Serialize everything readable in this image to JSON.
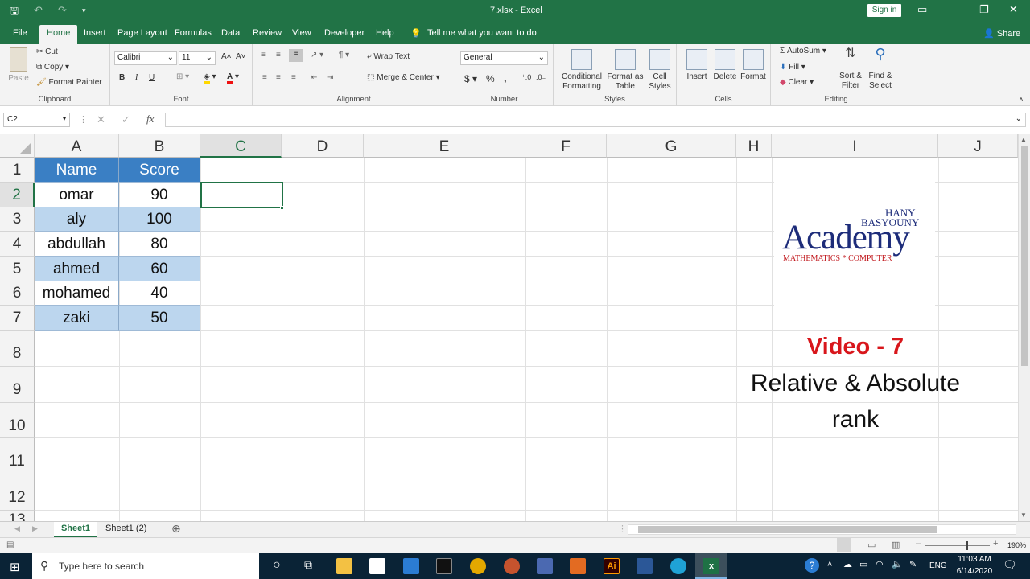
{
  "window": {
    "title": "7.xlsx  -  Excel",
    "signin": "Sign in",
    "share": "Share"
  },
  "tabs": [
    "File",
    "Home",
    "Insert",
    "Page Layout",
    "Formulas",
    "Data",
    "Review",
    "View",
    "Developer",
    "Help"
  ],
  "tellme": "Tell me what you want to do",
  "ribbon": {
    "clipboard": {
      "paste": "Paste",
      "cut": "Cut",
      "copy": "Copy",
      "format_painter": "Format Painter",
      "label": "Clipboard"
    },
    "font": {
      "name": "Calibri",
      "size": "11",
      "bold": "B",
      "italic": "I",
      "underline": "U",
      "label": "Font"
    },
    "alignment": {
      "wrap": "Wrap Text",
      "merge": "Merge & Center",
      "label": "Alignment"
    },
    "number": {
      "format": "General",
      "currency": "$",
      "percent": "%",
      "comma": ",",
      "label": "Number"
    },
    "styles": {
      "conditional": "Conditional\nFormatting",
      "format_table": "Format as\nTable",
      "cell_styles": "Cell\nStyles",
      "label": "Styles"
    },
    "cells": {
      "insert": "Insert",
      "delete": "Delete",
      "format": "Format",
      "label": "Cells"
    },
    "editing": {
      "autosum": "AutoSum",
      "fill": "Fill",
      "clear": "Clear",
      "sort": "Sort &\nFilter",
      "find": "Find &\nSelect",
      "label": "Editing"
    }
  },
  "namebox": "C2",
  "fx": "fx",
  "columns": [
    "A",
    "B",
    "C",
    "D",
    "E",
    "F",
    "G",
    "H",
    "I",
    "J"
  ],
  "rows": [
    "1",
    "2",
    "3",
    "4",
    "5",
    "6",
    "7",
    "8",
    "9",
    "10",
    "11",
    "12",
    "13"
  ],
  "table": {
    "headers": [
      "Name",
      "Score"
    ],
    "rows": [
      [
        "omar",
        "90"
      ],
      [
        "aly",
        "100"
      ],
      [
        "abdullah",
        "80"
      ],
      [
        "ahmed",
        "60"
      ],
      [
        "mohamed",
        "40"
      ],
      [
        "zaki",
        "50"
      ]
    ]
  },
  "logo": {
    "line1": "HANY",
    "line2": "BASYOUNY",
    "main": "Academy",
    "sub": "MATHEMATICS * COMPUTER"
  },
  "overlay": {
    "video": "Video - 7",
    "title1": "Relative & Absolute",
    "title2": "rank"
  },
  "sheets": [
    "Sheet1",
    "Sheet1 (2)"
  ],
  "status": {
    "zoom": "190%"
  },
  "taskbar": {
    "search": "Type here to search",
    "lang": "ENG",
    "time": "11:03 AM",
    "date": "6/14/2020"
  },
  "colors": {
    "excel_green": "#217346",
    "table_header": "#3a7fc4",
    "band": "#bcd6ee",
    "video_red": "#d8161b",
    "logo_navy": "#1d2c7a"
  }
}
